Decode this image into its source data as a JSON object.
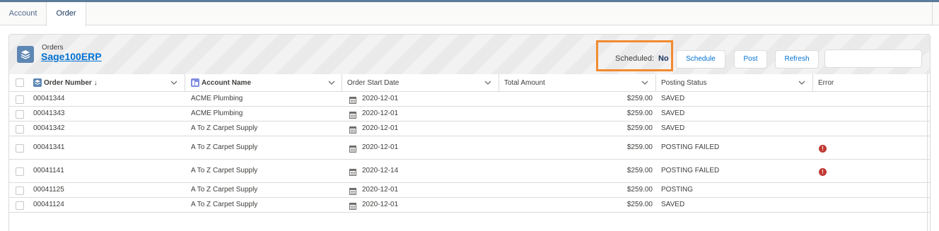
{
  "tabs": [
    {
      "label": "Account",
      "active": false
    },
    {
      "label": "Order",
      "active": true
    }
  ],
  "card": {
    "subtitle": "Orders",
    "title": "Sage100ERP",
    "icon": "stack-layers-icon",
    "scheduled_label": "Scheduled:",
    "scheduled_value": "No",
    "buttons": {
      "schedule": "Schedule",
      "post": "Post",
      "refresh": "Refresh"
    },
    "search_value": ""
  },
  "table": {
    "columns": [
      {
        "key": "order_number",
        "label": "Order Number",
        "sort_indicator": "↓",
        "icon": "order-icon"
      },
      {
        "key": "account_name",
        "label": "Account Name",
        "icon": "account-icon"
      },
      {
        "key": "order_start_date",
        "label": "Order Start Date"
      },
      {
        "key": "total_amount",
        "label": "Total Amount"
      },
      {
        "key": "posting_status",
        "label": "Posting Status"
      },
      {
        "key": "error",
        "label": "Error"
      }
    ],
    "rows": [
      {
        "order_number": "00041344",
        "account_name": "ACME Plumbing",
        "order_start_date": "2020-12-01",
        "total_amount": "$259.00",
        "posting_status": "SAVED",
        "error": false
      },
      {
        "order_number": "00041343",
        "account_name": "ACME Plumbing",
        "order_start_date": "2020-12-01",
        "total_amount": "$259.00",
        "posting_status": "SAVED",
        "error": false
      },
      {
        "order_number": "00041342",
        "account_name": "A To Z Carpet Supply",
        "order_start_date": "2020-12-01",
        "total_amount": "$259.00",
        "posting_status": "SAVED",
        "error": false
      },
      {
        "order_number": "00041341",
        "account_name": "A To Z Carpet Supply",
        "order_start_date": "2020-12-01",
        "total_amount": "$259.00",
        "posting_status": "POSTING FAILED",
        "error": true
      },
      {
        "order_number": "00041141",
        "account_name": "A To Z Carpet Supply",
        "order_start_date": "2020-12-14",
        "total_amount": "$259.00",
        "posting_status": "POSTING FAILED",
        "error": true
      },
      {
        "order_number": "00041125",
        "account_name": "A To Z Carpet Supply",
        "order_start_date": "2020-12-01",
        "total_amount": "$259.00",
        "posting_status": "POSTING",
        "error": false
      },
      {
        "order_number": "00041124",
        "account_name": "A To Z Carpet Supply",
        "order_start_date": "2020-12-01",
        "total_amount": "$259.00",
        "posting_status": "SAVED",
        "error": false
      }
    ]
  },
  "colors": {
    "highlight": "#f28b30",
    "link": "#0070d2",
    "error": "#c23934",
    "icon_bg": "#5e87b3"
  }
}
